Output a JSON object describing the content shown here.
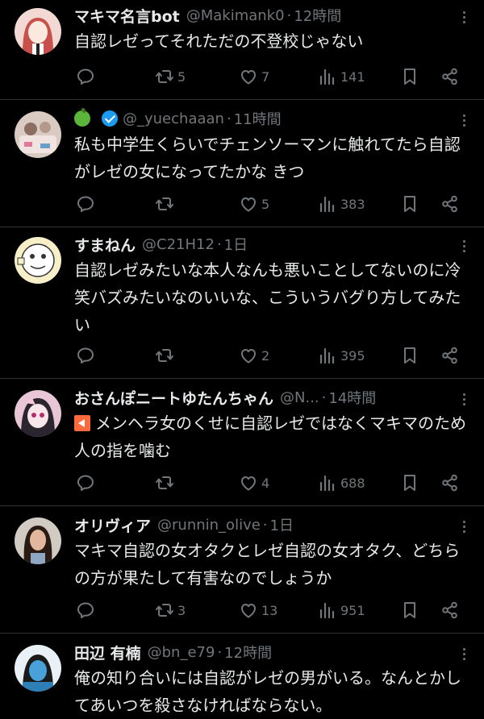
{
  "tweets": [
    {
      "name": "マキマ名言bot",
      "handle": "@Makimank0",
      "dot": "·",
      "time": "12時間",
      "text": "自認レゼってそれただの不登校じゃない",
      "reposts": "5",
      "likes": "7",
      "views": "141"
    },
    {
      "name": "",
      "handle": "@_yuechaaan",
      "dot": "·",
      "time": "11時間",
      "text": "私も中学生くらいでチェンソーマンに触れてたら自認がレゼの女になってたかな きつ",
      "reposts": "",
      "likes": "5",
      "views": "383"
    },
    {
      "name": "すまねん",
      "handle": "@C21H12",
      "dot": "·",
      "time": "1日",
      "text": "自認レゼみたいな本人なんも悪いことしてないのに冷笑バズみたいなのいいな、こういうバグり方してみたい",
      "reposts": "",
      "likes": "2",
      "views": "395"
    },
    {
      "name": "おさんぽニートゆたんちゃん",
      "handle": "@N...",
      "dot": "·",
      "time": "14時間",
      "text": "メンヘラ女のくせに自認レゼではなくマキマのため人の指を噛む",
      "reposts": "",
      "likes": "4",
      "views": "688"
    },
    {
      "name": "オリヴィア",
      "handle": "@runnin_olive",
      "dot": "·",
      "time": "1日",
      "text": "マキマ自認の女オタクとレゼ自認の女オタク、どちらの方が果たして有害なのでしょうか",
      "reposts": "3",
      "likes": "13",
      "views": "951"
    },
    {
      "name": "田辺 有楠",
      "handle": "@bn_e79",
      "dot": "·",
      "time": "12時間",
      "text": "俺の知り合いには自認がレゼの男がいる。なんとかしてあいつを殺さなければならない。",
      "reposts": "",
      "likes": "",
      "views": ""
    }
  ],
  "colors": {
    "background": "#000000",
    "text": "#e7e9ea",
    "muted": "#71767b",
    "verified": "#1d9bf0",
    "divider": "#2f3336"
  }
}
